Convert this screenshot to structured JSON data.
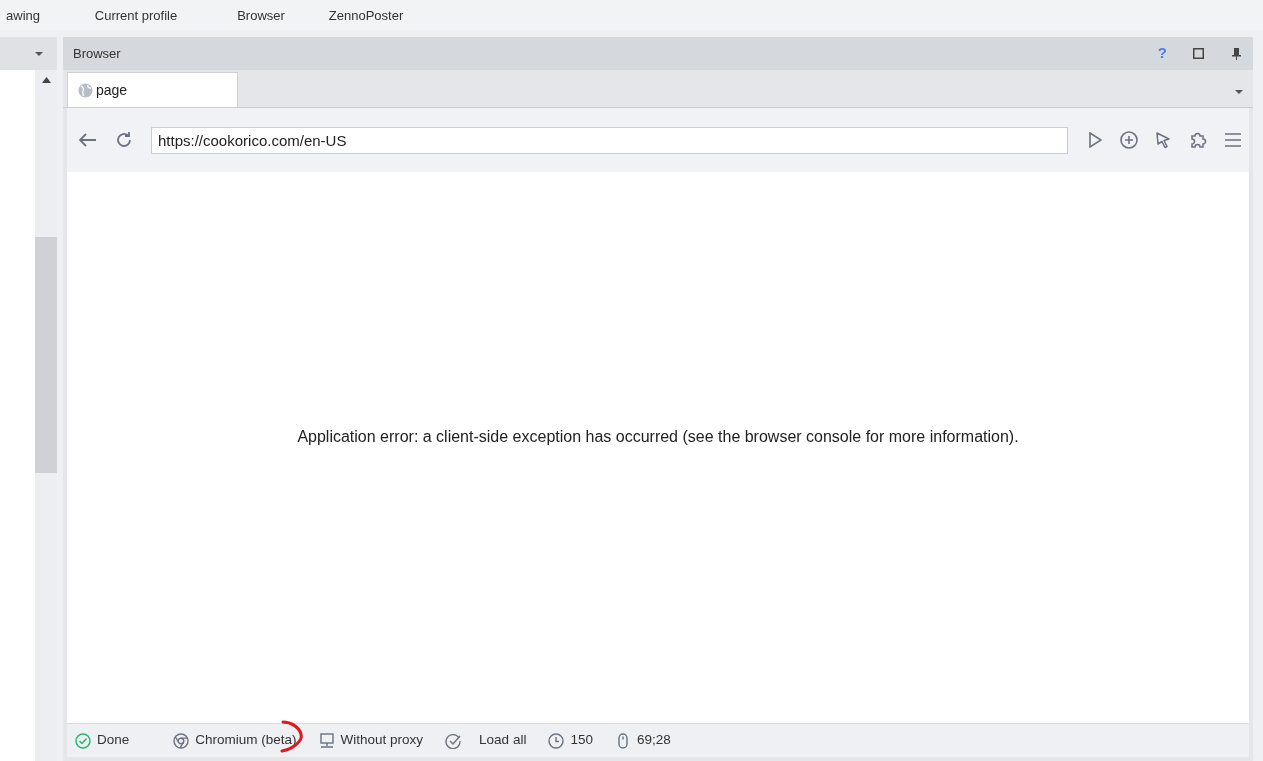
{
  "ribbon": [
    {
      "lines": [
        "awing"
      ]
    },
    {
      "lines": [
        "Current profile"
      ]
    },
    {
      "lines": [
        "Browser"
      ]
    },
    {
      "lines": [
        "ZennoPoster"
      ]
    }
  ],
  "panel": {
    "title": "Browser",
    "help": "?"
  },
  "tabs": [
    {
      "label": "page",
      "selected": true
    }
  ],
  "address": {
    "value": "https://cookorico.com/en-US"
  },
  "content": {
    "message": "Application error: a client-side exception has occurred (see the browser console for more information)."
  },
  "status_bar": [
    {
      "kind": "done",
      "label": "Done"
    },
    {
      "kind": "engine",
      "label": "Chromium (beta)"
    },
    {
      "kind": "proxy",
      "label": "Without proxy"
    },
    {
      "kind": "load",
      "label": "Load all"
    },
    {
      "kind": "timeout",
      "label": "150"
    },
    {
      "kind": "mouse",
      "label": "69;28"
    }
  ]
}
